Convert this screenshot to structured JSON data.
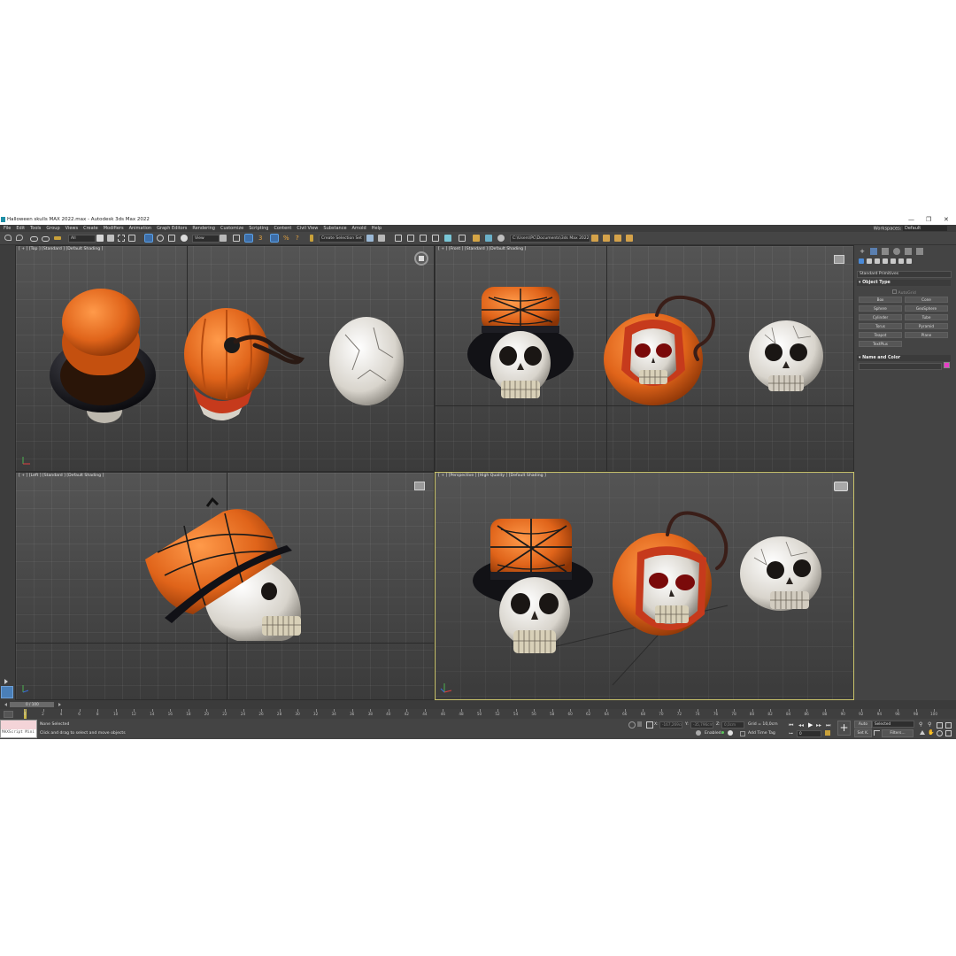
{
  "window": {
    "title": "Halloween skulls MAX 2022.max - Autodesk 3ds Max 2022",
    "minimize": "—",
    "restore": "❐",
    "close": "✕"
  },
  "menu": {
    "items": [
      "File",
      "Edit",
      "Tools",
      "Group",
      "Views",
      "Create",
      "Modifiers",
      "Animation",
      "Graph Editors",
      "Rendering",
      "Customize",
      "Scripting",
      "Content",
      "Civil View",
      "Substance",
      "Arnold",
      "Help"
    ],
    "workspaces_label": "Workspaces:",
    "workspaces_value": "Default"
  },
  "toolbar": {
    "filter_value": "All",
    "refcoord_value": "View",
    "selection_set": "Create Selection Set",
    "project_path": "C:\\Users\\PC\\Documents\\3ds Max 2022"
  },
  "viewports": {
    "top": "[ + ] [Top ] [Standard ] [Default Shading ]",
    "front": "[ + ] [Front ] [Standard ] [Default Shading ]",
    "left": "[ + ] [Left ] [Standard ] [Default Shading ]",
    "perspective": "[ + ] [Perspective ] [High Quality ] [Default Shading ]"
  },
  "command_panel": {
    "category": "Standard Primitives",
    "object_type_header": "Object Type",
    "autogrid": "AutoGrid",
    "buttons": [
      "Box",
      "Cone",
      "Sphere",
      "GeoSphere",
      "Cylinder",
      "Tube",
      "Torus",
      "Pyramid",
      "Teapot",
      "Plane",
      "TextPlus"
    ],
    "name_color_header": "Name and Color",
    "object_color": "#e83cc8"
  },
  "timeline": {
    "frame_display": "0 / 100",
    "ticks": [
      0,
      2,
      4,
      6,
      8,
      10,
      12,
      14,
      16,
      18,
      20,
      22,
      24,
      26,
      28,
      30,
      32,
      34,
      36,
      38,
      40,
      42,
      44,
      46,
      48,
      50,
      52,
      54,
      56,
      58,
      60,
      62,
      64,
      66,
      68,
      70,
      72,
      74,
      76,
      78,
      80,
      82,
      84,
      86,
      88,
      90,
      92,
      94,
      96,
      98,
      100
    ]
  },
  "status": {
    "maxscript": "MAXScript Mini",
    "selection": "None Selected",
    "prompt": "Click and drag to select and move objects",
    "x_label": "X:",
    "x_value": "-167,269cm",
    "y_label": "Y:",
    "y_value": "-35,796cm",
    "z_label": "Z:",
    "z_value": "0,0cm",
    "grid": "Grid = 10,0cm",
    "enabled": "Enabled:",
    "add_time_tag": "Add Time Tag",
    "auto": "Auto",
    "selected": "Selected",
    "setk": "Set K.",
    "filters": "Filters...",
    "frame": "0"
  },
  "colors": {
    "accent": "#5aa0e8",
    "pumpkin": "#e0641a",
    "bone": "#e8e4dc"
  }
}
